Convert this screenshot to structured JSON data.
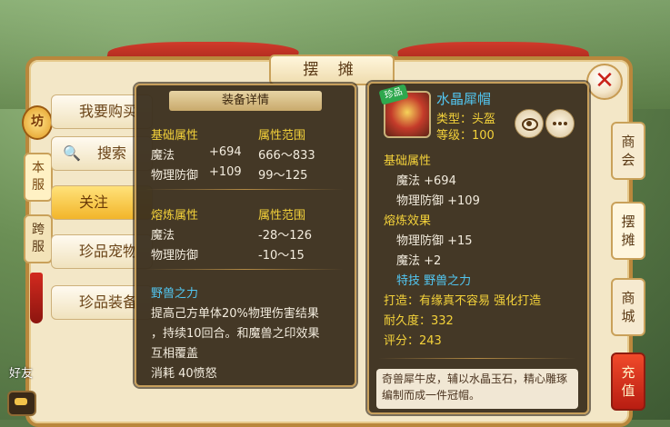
{
  "window": {
    "title": "摆 摊"
  },
  "left_badge": "坊",
  "left_tabs": [
    "本服",
    "跨服"
  ],
  "categories": [
    "我要购买",
    "搜索",
    "关注",
    "珍品宠物",
    "珍品装备"
  ],
  "right_tabs": [
    "商会",
    "摆摊",
    "商城",
    "充值"
  ],
  "friend_label": "好友",
  "detail_popup": {
    "title": "装备详情",
    "basic_header": "基础属性",
    "basic_range_header": "属性范围",
    "basic_rows": [
      {
        "name": "魔法",
        "value": "+694",
        "range": "666～833"
      },
      {
        "name": "物理防御",
        "value": "+109",
        "range": "99～125"
      }
    ],
    "refine_header": "熔炼属性",
    "refine_range_header": "属性范围",
    "refine_rows": [
      {
        "name": "魔法",
        "range": "-28～126"
      },
      {
        "name": "物理防御",
        "range": "-10～15"
      }
    ],
    "skill_name": "野兽之力",
    "skill_desc_lines": [
      "提高己方单体20%物理伤害结果",
      "，持续10回合。和魔兽之印效果",
      "互相覆盖"
    ],
    "skill_cost": "消耗 40愤怒"
  },
  "item_popup": {
    "bound_tag": "珍品",
    "name": "水晶犀帽",
    "type_line": "类型：头盔",
    "level_line": "等级：100",
    "basic_header": "基础属性",
    "basic_rows": [
      "魔法 +694",
      "物理防御 +109"
    ],
    "refine_header": "熔炼效果",
    "refine_rows": [
      "物理防御 +15",
      "魔法 +2"
    ],
    "skill_line": "特技  野兽之力",
    "maker_line": "打造：有缘真不容易  强化打造",
    "durability_line": "耐久度：332",
    "score_line": "评分：243",
    "description": "奇兽犀牛皮，辅以水晶玉石，精心雕琢编制而成一件冠帽。"
  },
  "colors": {
    "accent_yellow": "#f4d23a",
    "skill_blue": "#52c7f2",
    "frame_gold": "#c79f5b"
  }
}
